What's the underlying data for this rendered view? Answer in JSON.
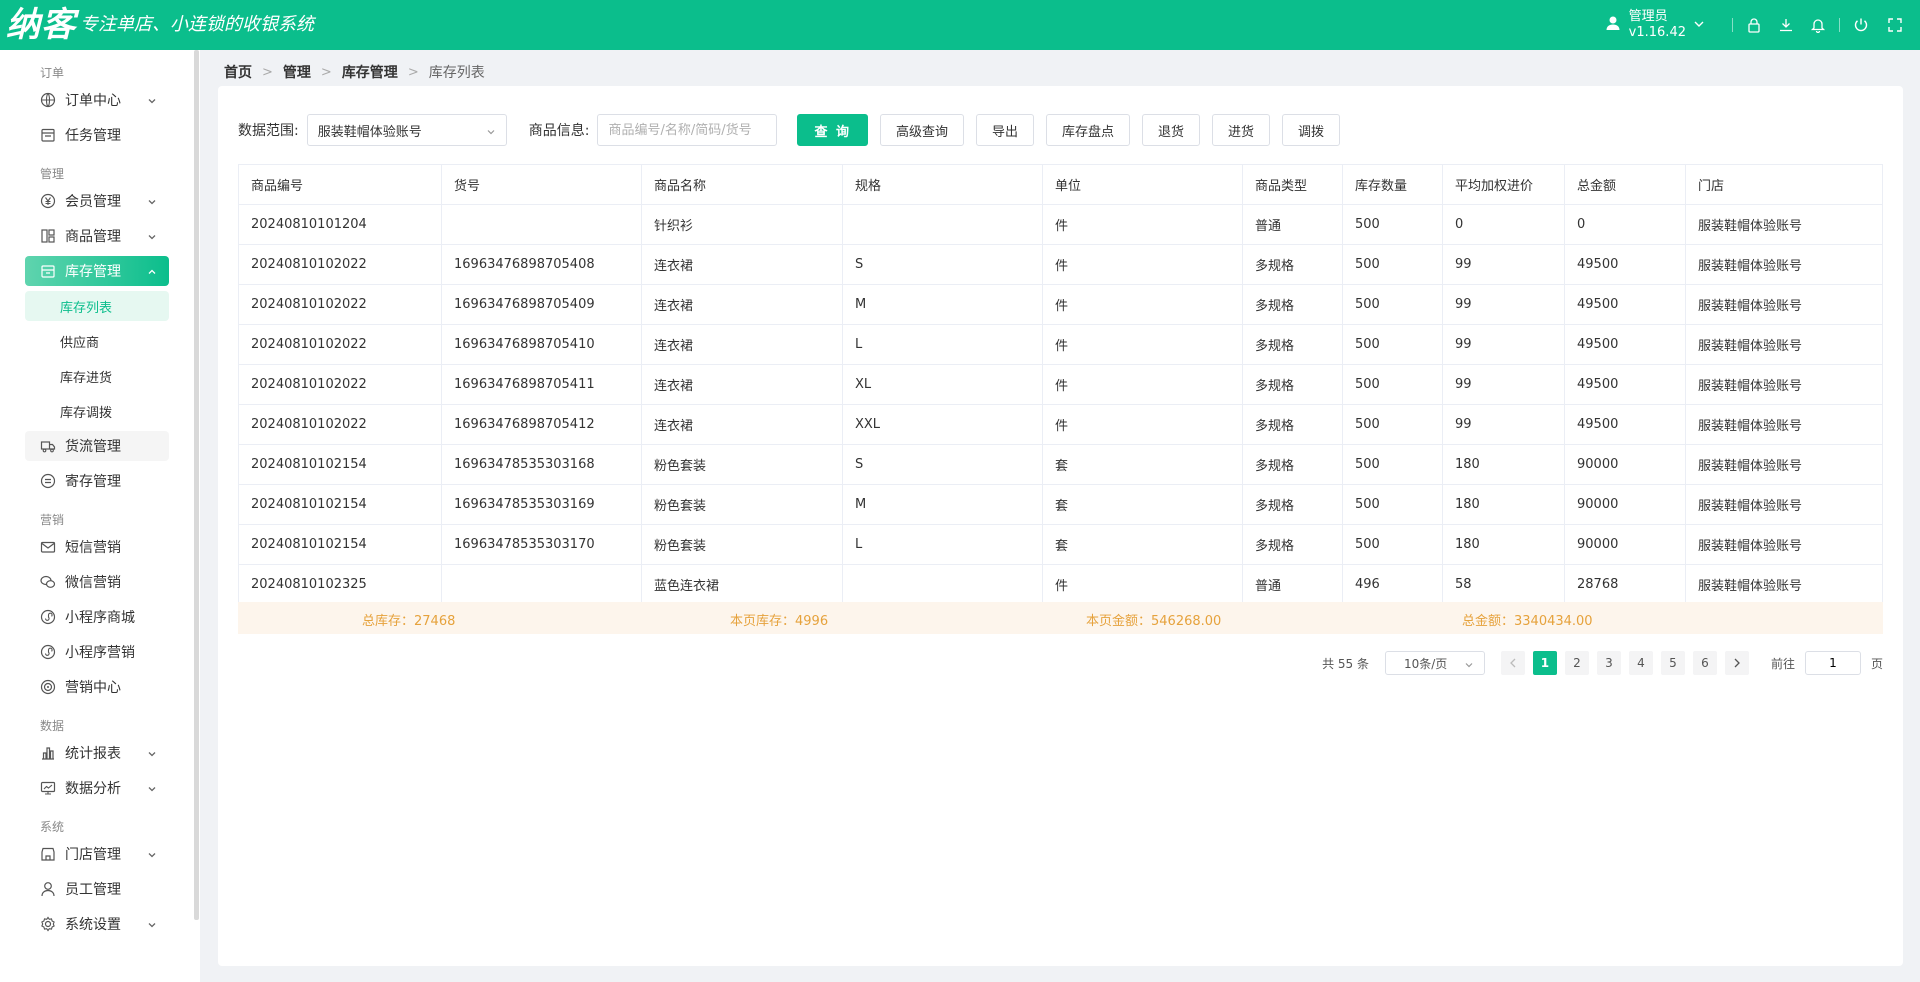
{
  "header": {
    "logo": "纳客",
    "slogan": "专注单店、小连锁的收银系统",
    "user_name": "管理员",
    "version": "v1.16.42"
  },
  "sidebar": {
    "groups": [
      {
        "label": "订单",
        "items": [
          {
            "label": "订单中心",
            "icon": "globe-icon",
            "has_chevron": true
          },
          {
            "label": "任务管理",
            "icon": "calendar-icon",
            "has_chevron": false
          }
        ]
      },
      {
        "label": "管理",
        "items": [
          {
            "label": "会员管理",
            "icon": "yen-icon",
            "has_chevron": true
          },
          {
            "label": "商品管理",
            "icon": "grid-icon",
            "has_chevron": true
          },
          {
            "label": "库存管理",
            "icon": "warehouse-icon",
            "has_chevron": true,
            "active": true
          },
          {
            "label": "货流管理",
            "icon": "truck-icon",
            "has_chevron": false
          },
          {
            "label": "寄存管理",
            "icon": "box-icon",
            "has_chevron": false
          }
        ]
      },
      {
        "label": "营销",
        "items": [
          {
            "label": "短信营销",
            "icon": "mail-icon",
            "has_chevron": false
          },
          {
            "label": "微信营销",
            "icon": "wechat-icon",
            "has_chevron": false
          },
          {
            "label": "小程序商城",
            "icon": "miniapp-icon",
            "has_chevron": false
          },
          {
            "label": "小程序营销",
            "icon": "miniapp-icon",
            "has_chevron": false
          },
          {
            "label": "营销中心",
            "icon": "target-icon",
            "has_chevron": false
          }
        ]
      },
      {
        "label": "数据",
        "items": [
          {
            "label": "统计报表",
            "icon": "bar-chart-icon",
            "has_chevron": true
          },
          {
            "label": "数据分析",
            "icon": "monitor-icon",
            "has_chevron": true
          }
        ]
      },
      {
        "label": "系统",
        "items": [
          {
            "label": "门店管理",
            "icon": "store-icon",
            "has_chevron": true
          },
          {
            "label": "员工管理",
            "icon": "user-icon",
            "has_chevron": false
          },
          {
            "label": "系统设置",
            "icon": "gear-icon",
            "has_chevron": true
          }
        ]
      }
    ],
    "inventory_sub": [
      "库存列表",
      "供应商",
      "库存进货",
      "库存调拨"
    ]
  },
  "breadcrumb": [
    "首页",
    "管理",
    "库存管理",
    "库存列表"
  ],
  "filter": {
    "range_label": "数据范围:",
    "range_value": "服装鞋帽体验账号",
    "info_label": "商品信息:",
    "info_placeholder": "商品编号/名称/简码/货号",
    "buttons": [
      "查 询",
      "高级查询",
      "导出",
      "库存盘点",
      "退货",
      "进货",
      "调拨"
    ]
  },
  "table": {
    "columns": [
      "商品编号",
      "货号",
      "商品名称",
      "规格",
      "单位",
      "商品类型",
      "库存数量",
      "平均加权进价",
      "总金额",
      "门店"
    ],
    "rows": [
      [
        "20240810101204",
        "",
        "针织衫",
        "",
        "件",
        "普通",
        "500",
        "0",
        "0",
        "服装鞋帽体验账号"
      ],
      [
        "20240810102022",
        "16963476898705408",
        "连衣裙",
        "S",
        "件",
        "多规格",
        "500",
        "99",
        "49500",
        "服装鞋帽体验账号"
      ],
      [
        "20240810102022",
        "16963476898705409",
        "连衣裙",
        "M",
        "件",
        "多规格",
        "500",
        "99",
        "49500",
        "服装鞋帽体验账号"
      ],
      [
        "20240810102022",
        "16963476898705410",
        "连衣裙",
        "L",
        "件",
        "多规格",
        "500",
        "99",
        "49500",
        "服装鞋帽体验账号"
      ],
      [
        "20240810102022",
        "16963476898705411",
        "连衣裙",
        "XL",
        "件",
        "多规格",
        "500",
        "99",
        "49500",
        "服装鞋帽体验账号"
      ],
      [
        "20240810102022",
        "16963476898705412",
        "连衣裙",
        "XXL",
        "件",
        "多规格",
        "500",
        "99",
        "49500",
        "服装鞋帽体验账号"
      ],
      [
        "20240810102154",
        "16963478535303168",
        "粉色套装",
        "S",
        "套",
        "多规格",
        "500",
        "180",
        "90000",
        "服装鞋帽体验账号"
      ],
      [
        "20240810102154",
        "16963478535303169",
        "粉色套装",
        "M",
        "套",
        "多规格",
        "500",
        "180",
        "90000",
        "服装鞋帽体验账号"
      ],
      [
        "20240810102154",
        "16963478535303170",
        "粉色套装",
        "L",
        "套",
        "多规格",
        "500",
        "180",
        "90000",
        "服装鞋帽体验账号"
      ],
      [
        "20240810102325",
        "",
        "蓝色连衣裙",
        "",
        "件",
        "普通",
        "496",
        "58",
        "28768",
        "服装鞋帽体验账号"
      ]
    ]
  },
  "summary": {
    "total_stock": "总库存：27468",
    "page_stock": "本页库存：4996",
    "page_amount": "本页金额：546268.00",
    "total_amount": "总金额：3340434.00"
  },
  "pagination": {
    "total": "共 55 条",
    "page_size": "10条/页",
    "pages": [
      "1",
      "2",
      "3",
      "4",
      "5",
      "6"
    ],
    "current": "1",
    "goto_label": "前往",
    "goto_value": "1",
    "page_suffix": "页"
  },
  "colors": {
    "brand": "#0bbe8c",
    "summary_text": "#e6a23c"
  }
}
